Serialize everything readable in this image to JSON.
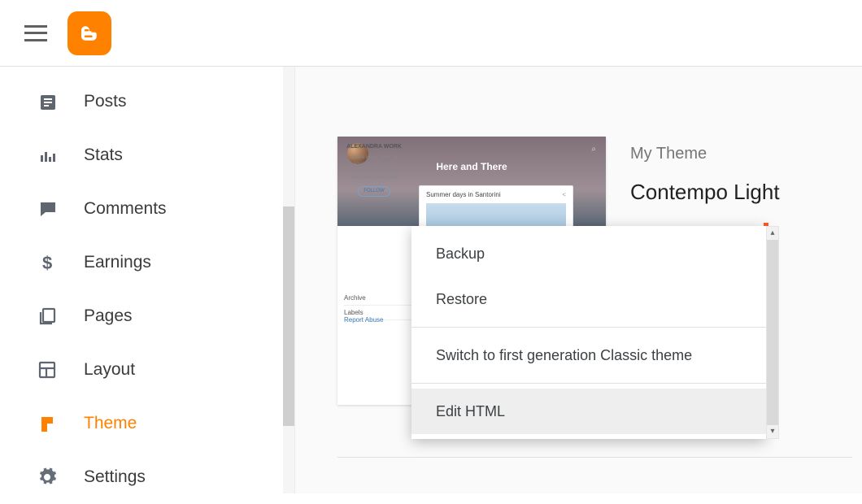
{
  "sidebar": {
    "items": [
      {
        "label": "Posts",
        "name": "sidebar-item-posts",
        "icon": "posts"
      },
      {
        "label": "Stats",
        "name": "sidebar-item-stats",
        "icon": "stats"
      },
      {
        "label": "Comments",
        "name": "sidebar-item-comments",
        "icon": "comments"
      },
      {
        "label": "Earnings",
        "name": "sidebar-item-earnings",
        "icon": "earnings"
      },
      {
        "label": "Pages",
        "name": "sidebar-item-pages",
        "icon": "pages"
      },
      {
        "label": "Layout",
        "name": "sidebar-item-layout",
        "icon": "layout"
      },
      {
        "label": "Theme",
        "name": "sidebar-item-theme",
        "icon": "theme",
        "active": true
      },
      {
        "label": "Settings",
        "name": "sidebar-item-settings",
        "icon": "settings"
      }
    ]
  },
  "theme": {
    "section_label": "My Theme",
    "name": "Contempo Light",
    "preview": {
      "blog_title": "Here and There",
      "post_title": "Summer days in Santorini",
      "archive_label": "Archive",
      "labels_label": "Labels",
      "report_label": "Report Abuse",
      "author_name": "ALEXANDRA WORK"
    }
  },
  "menu": {
    "items": [
      {
        "label": "Backup",
        "name": "menu-item-backup"
      },
      {
        "label": "Restore",
        "name": "menu-item-restore"
      },
      {
        "label": "Switch to first generation Classic theme",
        "name": "menu-item-switch-classic"
      },
      {
        "label": "Edit HTML",
        "name": "menu-item-edit-html",
        "hover": true
      }
    ]
  },
  "colors": {
    "brand": "#ff8100"
  }
}
